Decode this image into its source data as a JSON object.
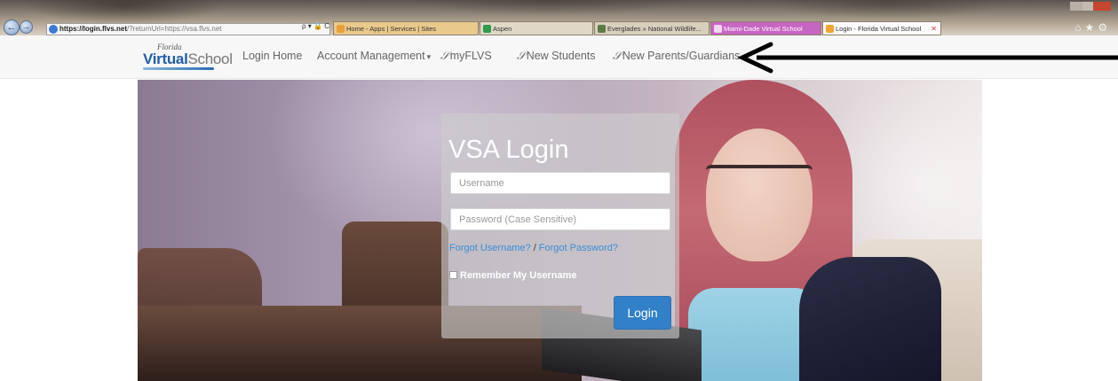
{
  "browser": {
    "address": {
      "host": "https://login.flvs.net",
      "path": "/?returnUrl=https://vsa.flvs.net"
    },
    "address_tools": "ρ ▾ 🔒 C",
    "tabs": [
      {
        "label": "Home - Apps | Services | Sites"
      },
      {
        "label": "Aspen"
      },
      {
        "label": "Everglades » National Wildlife..."
      },
      {
        "label": "Miami-Dade Virtual School"
      },
      {
        "label": "Login - Florida Virtual School",
        "active": true
      }
    ],
    "toolbar_icons": [
      "home-icon",
      "star-icon",
      "gear-icon"
    ],
    "toolbar_glyphs": "⌂★⚙"
  },
  "site": {
    "logo": {
      "small": "Florida",
      "bold": "Virtual",
      "rest": "School"
    },
    "nav": {
      "login_home": "Login Home",
      "account_management": "Account Management",
      "account_caret": "▾",
      "myflvs": "myFLVS",
      "new_students": "New Students",
      "new_parents": "New Parents/Guardians",
      "link_icon": "𝒮"
    }
  },
  "login": {
    "title": "VSA Login",
    "username_placeholder": "Username",
    "password_placeholder": "Password (Case Sensitive)",
    "forgot_username": "Forgot Username?",
    "separator": "/",
    "forgot_password": "Forgot Password?",
    "remember_label": "Remember My Username",
    "button": "Login"
  },
  "colors": {
    "brand_blue": "#245ea8",
    "button_blue": "#3280c8",
    "link_blue": "#3b8ed6",
    "arrow": "#000000"
  }
}
